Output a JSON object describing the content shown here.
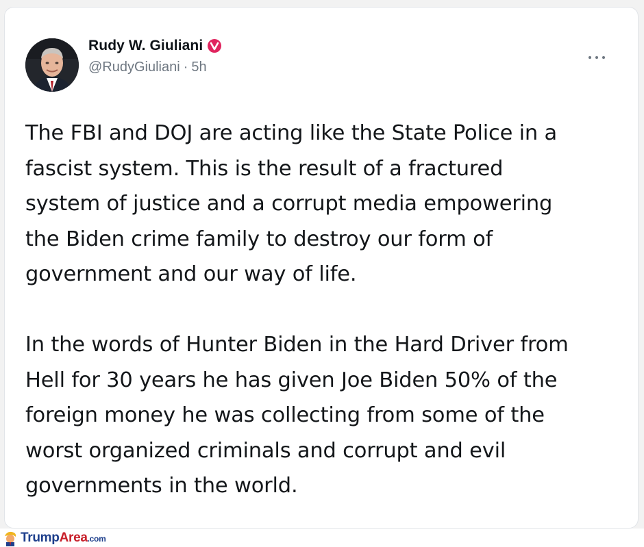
{
  "tweet": {
    "author": {
      "display_name": "Rudy W. Giuliani",
      "handle": "@RudyGiuliani",
      "verified_icon": "verified-badge-icon",
      "verified_color": "#e0245e"
    },
    "separator": "·",
    "timestamp": "5h",
    "more_icon": "more-options-icon",
    "paragraphs": [
      "The FBI and DOJ are acting like the State Police in a\nfascist system.  This is the result of a fractured\nsystem of justice and a corrupt media empowering\nthe Biden crime family to destroy our form of\ngovernment and our way of life.",
      "In the words of Hunter Biden in the Hard Driver from\nHell for 30 years he has given Joe Biden 50% of the\nforeign money he was collecting from some of the\nworst organized criminals and corrupt and evil\ngovernments in the world."
    ]
  },
  "watermark": {
    "part1": "Trump",
    "part2": "Area",
    "part3": ".com"
  }
}
